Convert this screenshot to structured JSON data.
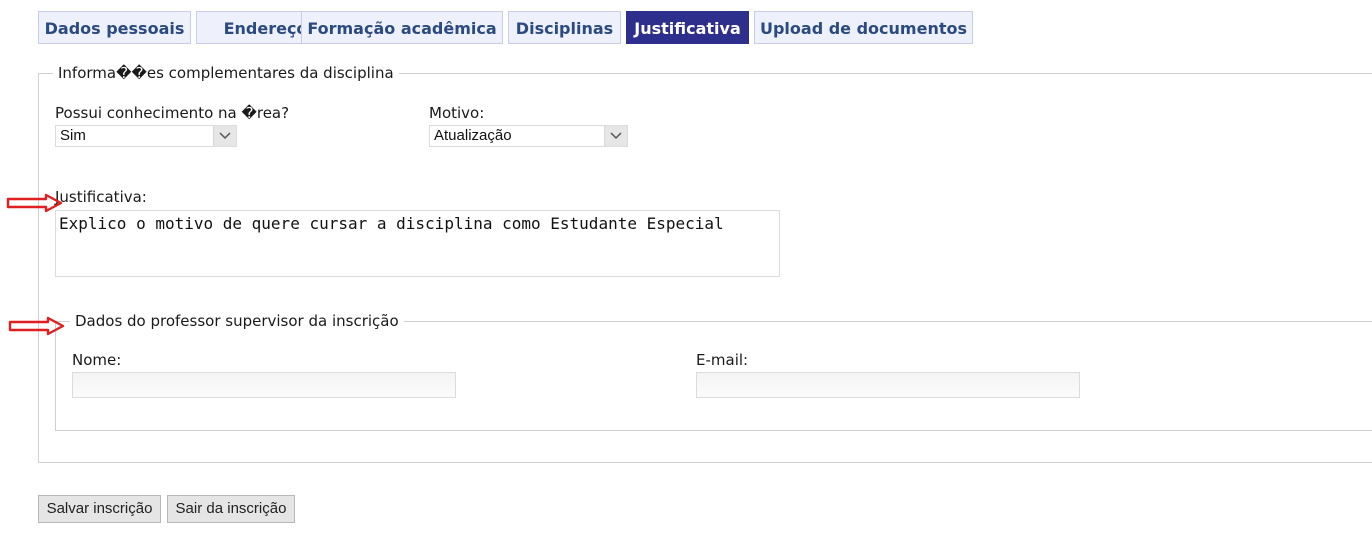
{
  "tabs": [
    {
      "label": "Dados pessoais"
    },
    {
      "label": "Endereço"
    },
    {
      "label": "Formação acadêmica"
    },
    {
      "label": "Disciplinas"
    },
    {
      "label": "Justificativa",
      "active": true
    },
    {
      "label": "Upload de documentos"
    }
  ],
  "section": {
    "legend": "Informa��es complementares da disciplina",
    "conhecimento": {
      "label": "Possui conhecimento na �rea?",
      "value": "Sim"
    },
    "motivo": {
      "label": "Motivo:",
      "value": "Atualização"
    },
    "justificativa": {
      "label": "Justificativa:",
      "value": "Explico o motivo de quere cursar a disciplina como Estudante Especial"
    }
  },
  "professor": {
    "legend": "Dados do professor supervisor da inscrição",
    "nome": {
      "label": "Nome:",
      "value": ""
    },
    "email": {
      "label": "E-mail:",
      "value": ""
    }
  },
  "buttons": {
    "save": "Salvar inscrição",
    "exit": "Sair da inscrição"
  },
  "colors": {
    "active_tab": "#2e2f8c",
    "tab_text": "#2b4a7f",
    "annotation_arrow": "#e02020"
  }
}
